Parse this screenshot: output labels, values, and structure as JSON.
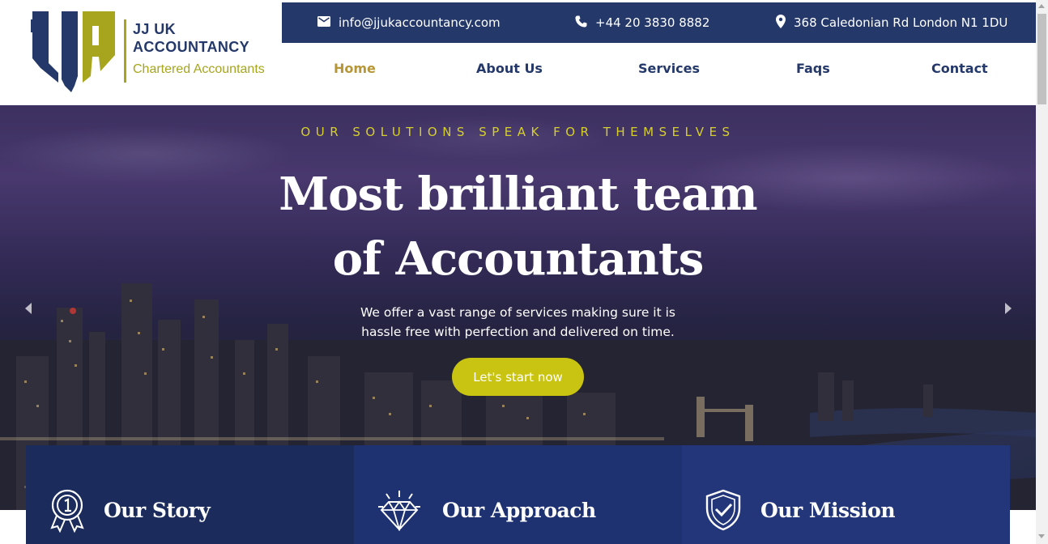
{
  "brand": {
    "line1": "JJ UK",
    "line2": "ACCOUNTANCY",
    "line3": "Chartered Accountants",
    "monogram": "JJA",
    "colors": {
      "navy": "#24386a",
      "olive": "#a6a51d"
    }
  },
  "topbar": {
    "email": "info@jjukaccountancy.com",
    "phone": "+44 20 3830 8882",
    "address": "368 Caledonian Rd London N1 1DU",
    "icons": {
      "email": "mail-icon",
      "phone": "phone-icon",
      "address": "location-pin-icon"
    }
  },
  "nav": {
    "items": [
      "Home",
      "About Us",
      "Services",
      "Faqs",
      "Contact"
    ],
    "active": "Home",
    "colors": {
      "default": "#24386a",
      "active": "#b79638"
    }
  },
  "hero": {
    "eyebrow": "OUR SOLUTIONS SPEAK FOR THEMSELVES",
    "headline_line1": "Most brilliant team",
    "headline_line2": "of Accountants",
    "subtext_line1": "We offer a vast range of services making sure it is",
    "subtext_line2": "hassle free with perfection and delivered on time.",
    "cta_label": "Let's start now",
    "colors": {
      "eyebrow": "#d6cf2a",
      "cta": "#c9c412"
    }
  },
  "cards": [
    {
      "title": "Our Story",
      "icon": "award-ribbon-icon"
    },
    {
      "title": "Our Approach",
      "icon": "diamond-icon"
    },
    {
      "title": "Our Mission",
      "icon": "shield-check-icon"
    }
  ]
}
